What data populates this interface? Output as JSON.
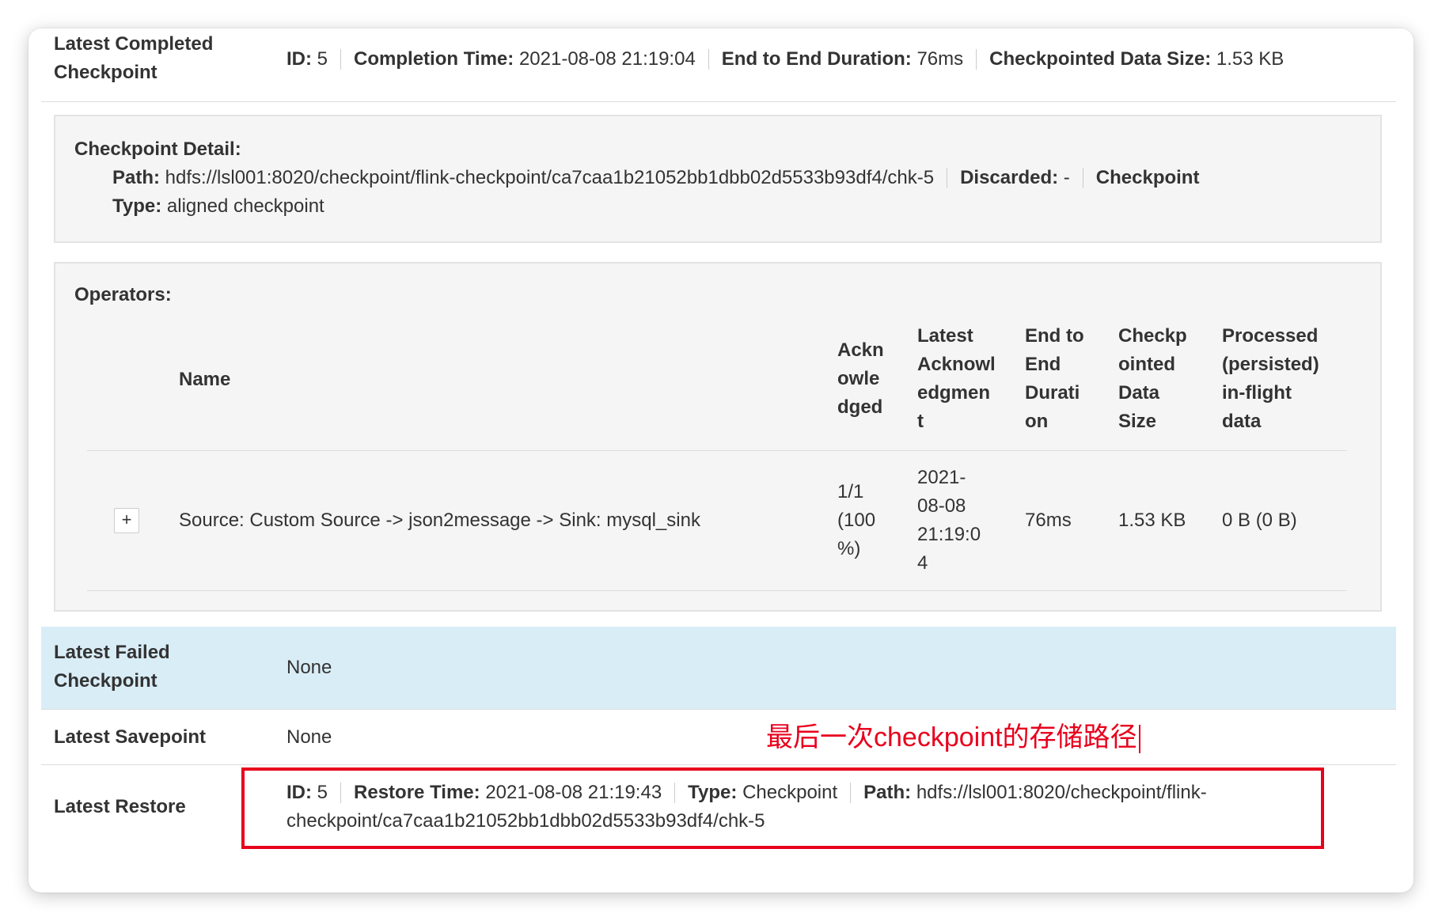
{
  "latest_completed": {
    "label_line1": "Latest Completed",
    "label_line2": "Checkpoint",
    "fields": [
      {
        "key": "ID:",
        "value": "5"
      },
      {
        "key": "Completion Time:",
        "value": "2021-08-08 21:19:04"
      },
      {
        "key": "End to End Duration:",
        "value": "76ms"
      },
      {
        "key": "Checkpointed Data Size:",
        "value": "1.53 KB"
      }
    ]
  },
  "checkpoint_detail": {
    "title": "Checkpoint Detail:",
    "path_key": "Path:",
    "path_value": "hdfs://lsl001:8020/checkpoint/flink-checkpoint/ca7caa1b21052bb1dbb02d5533b93df4/chk-5",
    "discarded_key": "Discarded:",
    "discarded_value": "-",
    "type_key_1": "Checkpoint",
    "type_key_2": "Type:",
    "type_value": "aligned checkpoint"
  },
  "operators": {
    "title": "Operators:",
    "columns": {
      "name": "Name",
      "acknowledged": [
        "Ackn",
        "owle",
        "dged"
      ],
      "latest_ack": [
        "Latest",
        "Acknowl",
        "edgmen",
        "t"
      ],
      "e2e": [
        "End to",
        "End",
        "Durati",
        "on"
      ],
      "size": [
        "Checkp",
        "ointed",
        "Data",
        "Size"
      ],
      "processed": [
        "Processed",
        "(persisted)",
        "in-flight",
        "data"
      ]
    },
    "rows": [
      {
        "expand": "+",
        "name": "Source: Custom Source -> json2message -> Sink: mysql_sink",
        "acknowledged": [
          "1/1",
          "(100",
          "%)"
        ],
        "latest_ack": [
          "2021-",
          "08-08",
          "21:19:0",
          "4"
        ],
        "e2e": "76ms",
        "size": "1.53 KB",
        "processed": "0 B (0 B)"
      }
    ]
  },
  "latest_failed": {
    "label_line1": "Latest Failed",
    "label_line2": "Checkpoint",
    "value": "None",
    "band_color": "#d9edf7"
  },
  "latest_savepoint": {
    "label": "Latest Savepoint",
    "value": "None"
  },
  "annotation": {
    "text": "最后一次checkpoint的存储路径",
    "color": "#e8001c"
  },
  "latest_restore": {
    "label": "Latest Restore",
    "id_key": "ID:",
    "id_value": "5",
    "time_key": "Restore Time:",
    "time_value": "2021-08-08 21:19:43",
    "type_key": "Type:",
    "type_value": "Checkpoint",
    "path_key": "Path:",
    "path_value_line1": "hdfs://lsl001:8020/checkpoint/flink-",
    "path_value_line2": "checkpoint/ca7caa1b21052bb1dbb02d5533b93df4/chk-5"
  }
}
